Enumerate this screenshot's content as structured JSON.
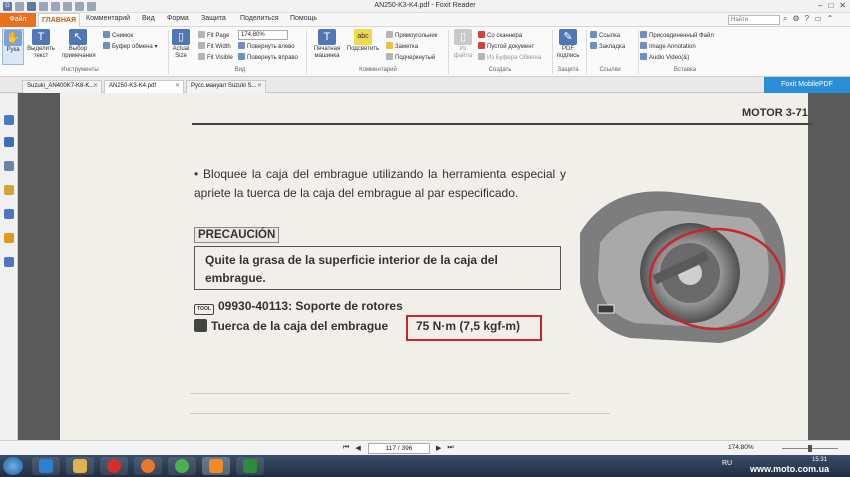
{
  "window": {
    "title": "AN250-K3-K4.pdf - Foxit Reader",
    "controls": [
      "–",
      "□",
      "✕"
    ]
  },
  "ribbon_tabs": {
    "file": "Файл",
    "items": [
      "ГЛАВНАЯ",
      "Комментарий",
      "Вид",
      "Форма",
      "Защита",
      "Поделиться",
      "Помощь"
    ],
    "search_placeholder": "Найти"
  },
  "ribbon": {
    "tools": {
      "hand": "Рука",
      "select_text": "Выделить текст",
      "select_annotation": "Выбор примечания",
      "snapshot": "Снимок",
      "clipboard": "Буфер обмена",
      "group": "Инструменты"
    },
    "view": {
      "actual_size": "Actual Size",
      "fit_page": "Fit Page",
      "fit_width": "Fit Width",
      "fit_visible": "Fit Visible",
      "zoom": "174.80%",
      "rotate_left": "Повернуть влево",
      "rotate_right": "Повернуть вправо",
      "group": "Вид"
    },
    "comment": {
      "typewriter": "Печатная машинка",
      "highlight": "Подсветить",
      "rectangle": "Прямоугольник",
      "note": "Заметка",
      "underline": "Подчеркнутый",
      "group": "Комментарий"
    },
    "create": {
      "from_file": "Из файла",
      "from_scanner": "Со сканнера",
      "blank": "Пустой документ",
      "from_clipboard": "Из Буфера Обмена",
      "group": "Создать"
    },
    "protect": {
      "pdf_sign": "PDF подпись",
      "group": "Защита"
    },
    "links": {
      "link": "Ссылка",
      "bookmark": "Закладка",
      "group": "Ссылки"
    },
    "insert": {
      "attach": "Присоединенный Файл",
      "image_annotation": "Image Annotation",
      "audio_video": "Audio  Video(&)",
      "group": "Вставка"
    }
  },
  "doc_tabs": [
    {
      "label": "Suzuki_AN400K7-K8-K..."
    },
    {
      "label": "AN250-K3-K4.pdf"
    },
    {
      "label": "Русс.мануал Suzuki S..."
    }
  ],
  "mobile_button": "Foxit MobilePDF",
  "page": {
    "header": "MOTOR   3-71",
    "instruction": "• Bloquee la caja del embrague utilizando la herramienta especial y apriete la tuerca de la caja del embrague al par especificado.",
    "caution_label": "PRECAUCIÓN",
    "caution_text": "Quite la grasa de la superficie interior de la caja del embrague.",
    "tool_label": "TOOL",
    "tool_spec": "09930-40113: Soporte de rotores",
    "torque_label": "Tuerca de la caja del embrague",
    "torque_value": "75 N·m (7,5 kgf-m)"
  },
  "statusbar": {
    "page": "117 / 396",
    "zoom": "174.80%"
  },
  "taskbar": {
    "lang": "RU",
    "time": "15:31"
  },
  "watermark": "www.moto.com.ua",
  "colors": {
    "accent": "#e8701e",
    "mobile": "#2a8fd6",
    "highlight_box": "#c8262b"
  }
}
